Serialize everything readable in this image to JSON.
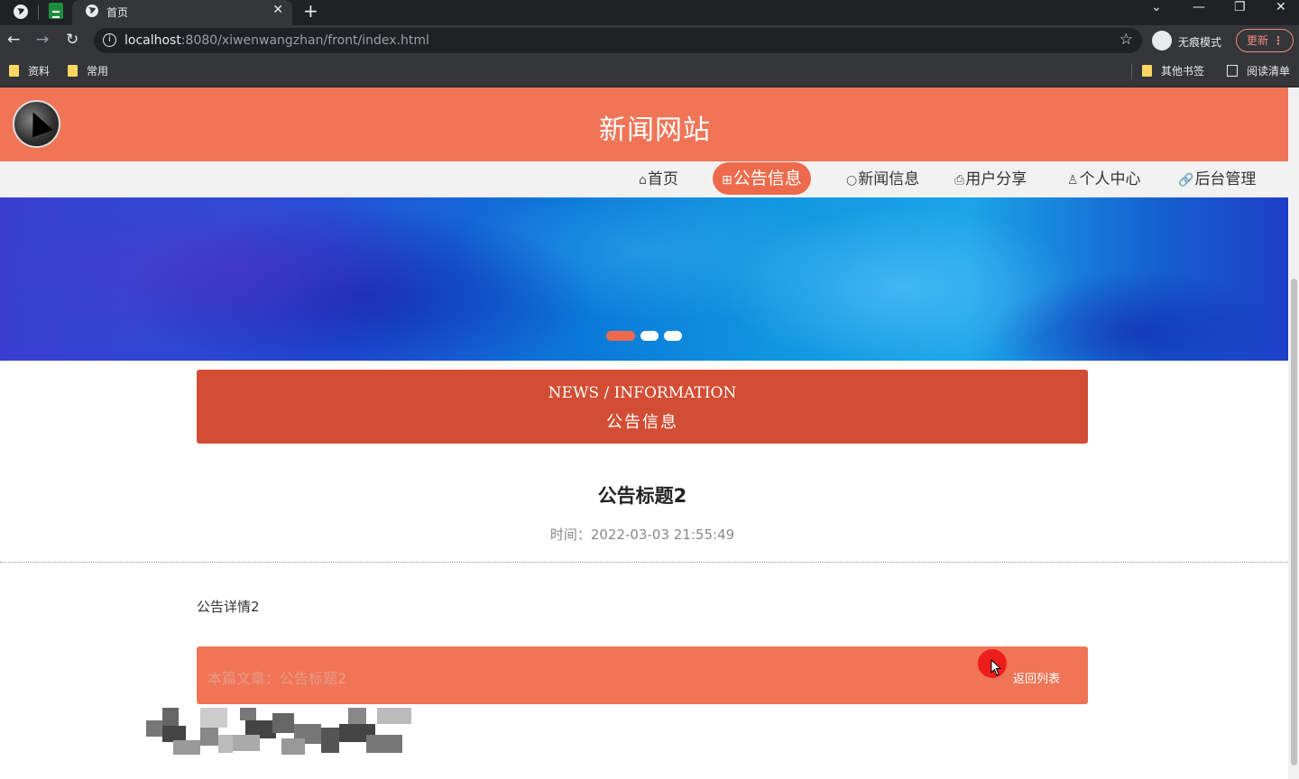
{
  "browser": {
    "tab_title": "首页",
    "url_host": "localhost",
    "url_rest": ":8080/xiwenwangzhan/front/index.html",
    "incognito_label": "无痕模式",
    "update_label": "更新",
    "bookmarks": [
      "资料",
      "常用"
    ],
    "bookmarks_right": {
      "other": "其他书签",
      "reading_list": "阅读清单"
    }
  },
  "site": {
    "title": "新闻网站",
    "nav": [
      {
        "label": "首页",
        "icon": "home-icon"
      },
      {
        "label": "公告信息",
        "icon": "gift-icon",
        "active": true
      },
      {
        "label": "新闻信息",
        "icon": "circle-icon"
      },
      {
        "label": "用户分享",
        "icon": "printer-icon"
      },
      {
        "label": "个人中心",
        "icon": "user-icon"
      },
      {
        "label": "后台管理",
        "icon": "link-icon"
      }
    ],
    "carousel": {
      "slides": 3,
      "active_index": 0
    }
  },
  "section": {
    "en": "NEWS / INFORMATION",
    "cn": "公告信息"
  },
  "article": {
    "title": "公告标题2",
    "time": "时间：2022-03-03 21:55:49",
    "body": "公告详情2"
  },
  "footer": {
    "label": "本篇文章：公告标题2",
    "back_label": "返回列表"
  },
  "colors": {
    "accent": "#f07456",
    "active_nav": "#ed6b4c",
    "section_banner": "#d24d33"
  }
}
